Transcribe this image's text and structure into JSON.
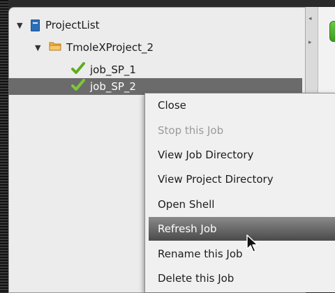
{
  "tree": {
    "items": [
      {
        "label": "ProjectList",
        "icon": "project-list-icon"
      },
      {
        "label": "TmoleXProject_2",
        "icon": "folder-icon"
      },
      {
        "label": "job_SP_1",
        "icon": "checkmark-icon"
      },
      {
        "label": "job_SP_2",
        "icon": "checkmark-icon"
      }
    ]
  },
  "context_menu": {
    "items": [
      {
        "label": "Close",
        "enabled": true
      },
      {
        "label": "Stop this Job",
        "enabled": false
      },
      {
        "label": "View Job Directory",
        "enabled": true
      },
      {
        "label": "View Project Directory",
        "enabled": true
      },
      {
        "label": "Open Shell",
        "enabled": true
      },
      {
        "label": "Refresh Job",
        "enabled": true,
        "highlighted": true
      },
      {
        "label": "Rename this Job",
        "enabled": true
      },
      {
        "label": "Delete this Job",
        "enabled": true
      }
    ]
  },
  "colors": {
    "selection": "#6b6b6b",
    "menu_highlight": "#5a5a5a",
    "check_green": "#5fae1e",
    "folder_orange": "#e89a2a",
    "project_blue": "#2c6fb8"
  }
}
